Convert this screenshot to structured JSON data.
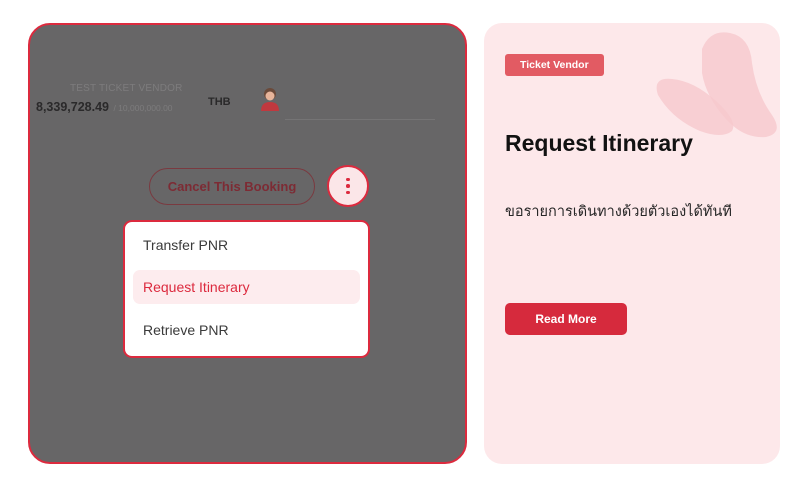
{
  "vendor": {
    "name": "TEST TICKET VENDOR",
    "balance": "8,339,728.49",
    "limit": "/ 10,000,000.00",
    "currency": "THB",
    "avatar_icon": "user-avatar-icon"
  },
  "actions": {
    "cancel_label": "Cancel This Booking",
    "more_icon": "vertical-ellipsis-icon"
  },
  "menu": {
    "items": [
      {
        "label": "Transfer PNR",
        "active": false
      },
      {
        "label": "Request Itinerary",
        "active": true
      },
      {
        "label": "Retrieve PNR",
        "active": false
      }
    ]
  },
  "card": {
    "tag": "Ticket Vendor",
    "title": "Request Itinerary",
    "description": "ขอรายการเดินทางด้วยตัวเองได้ทันที",
    "button_label": "Read More"
  },
  "colors": {
    "accent": "#dc2a3e",
    "overlay": "#676667",
    "card_bg": "#fde8ea",
    "tag_bg": "#e25b63",
    "active_item_bg": "#fdecee"
  }
}
